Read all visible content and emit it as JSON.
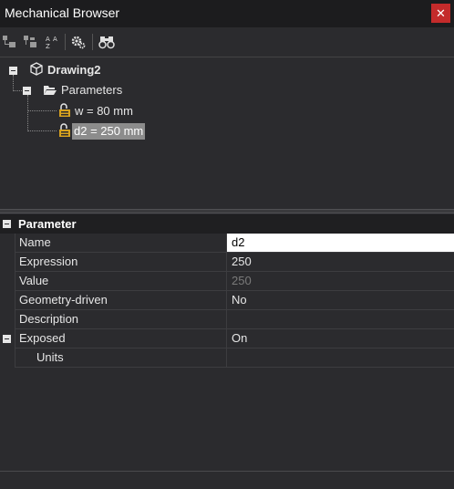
{
  "window": {
    "title": "Mechanical Browser",
    "close_glyph": "✕"
  },
  "toolbar": {
    "buttons": [
      {
        "icon": "collapse-tree-icon"
      },
      {
        "icon": "expand-tree-icon"
      },
      {
        "icon": "sort-az-icon"
      },
      {
        "icon": "settings-gear-icon"
      },
      {
        "icon": "binoculars-search-icon"
      }
    ]
  },
  "tree": {
    "root": {
      "label": "Drawing2"
    },
    "folder": {
      "label": "Parameters"
    },
    "items": [
      {
        "label": "w = 80 mm",
        "selected": false
      },
      {
        "label": "d2 = 250 mm",
        "selected": true
      }
    ]
  },
  "properties": {
    "category": "Parameter",
    "rows": [
      {
        "name": "Name",
        "value": "d2",
        "state": "editing"
      },
      {
        "name": "Expression",
        "value": "250",
        "state": "normal"
      },
      {
        "name": "Value",
        "value": "250",
        "state": "disabled"
      },
      {
        "name": "Geometry-driven",
        "value": "No",
        "state": "normal"
      },
      {
        "name": "Description",
        "value": "",
        "state": "normal"
      },
      {
        "name": "Exposed",
        "value": "On",
        "state": "normal"
      },
      {
        "name": "Units",
        "value": "",
        "state": "normal"
      }
    ]
  }
}
